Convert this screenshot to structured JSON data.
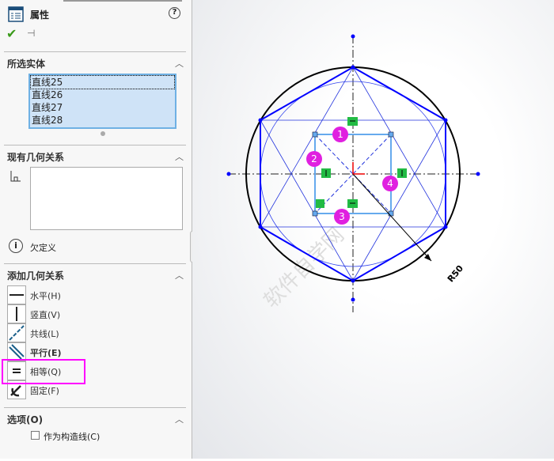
{
  "panel": {
    "title": "属性",
    "help": "?",
    "sections": {
      "selected": "所选实体",
      "existing": "现有几何关系",
      "add": "添加几何关系",
      "options": "选项(O)"
    },
    "selected_items": [
      "直线25",
      "直线26",
      "直线27",
      "直线28"
    ],
    "status": "欠定义",
    "relations": [
      {
        "label": "水平(H)",
        "icon": "horizontal-icon"
      },
      {
        "label": "竖直(V)",
        "icon": "vertical-icon"
      },
      {
        "label": "共线(L)",
        "icon": "collinear-icon"
      },
      {
        "label": "平行(E)",
        "icon": "parallel-icon"
      },
      {
        "label": "相等(Q)",
        "icon": "equal-icon"
      },
      {
        "label": "固定(F)",
        "icon": "fix-icon"
      }
    ],
    "construction_label": "作为构造线(C)"
  },
  "canvas": {
    "dimension": "R50",
    "markers": [
      "1",
      "2",
      "3",
      "4"
    ],
    "watermark": "软件自学网"
  },
  "colors": {
    "highlight": "#ff00ff",
    "sketch": "#0000ff",
    "marker": "#e020e0",
    "relation": "#22bb44"
  }
}
